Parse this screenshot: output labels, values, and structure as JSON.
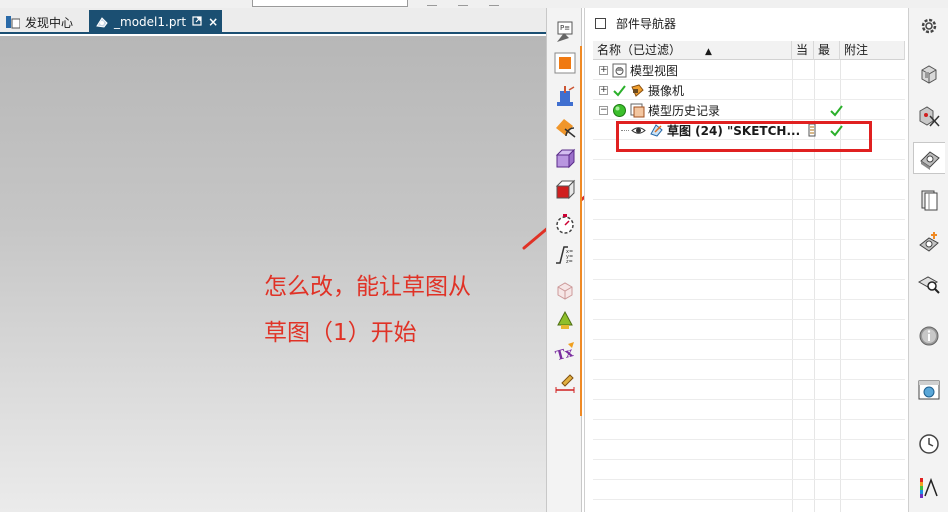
{
  "window": {
    "tabs": [
      {
        "label": "发现中心",
        "active": false
      },
      {
        "label": "_model1.prt",
        "active": true,
        "close_symbol": "×"
      }
    ]
  },
  "graphics": {
    "annotation_line1": "怎么改，能让草图从",
    "annotation_line2": "草图（1）开始",
    "annotation_color": "#e03226"
  },
  "vtoolbar": {
    "icons": [
      "selection-filter-icon",
      "orange-square-icon",
      "datum-csys-icon",
      "sketch-section-icon",
      "cube-wireframe-icon",
      "red-cube-icon",
      "clock-dial-icon",
      "expression-icon",
      "transparent-cube-icon",
      "lamp-icon",
      "text-icon",
      "measure-brush-icon"
    ]
  },
  "navigator": {
    "title": "部件导航器",
    "columns": {
      "name": "名称（已过滤）",
      "current": "当",
      "latest": "最",
      "notes": "附注"
    },
    "rows": [
      {
        "label": "模型视图",
        "expander": "+",
        "icon": "model-view-icon",
        "latest_check": false
      },
      {
        "label": "摄像机",
        "expander": "+",
        "icon": "camera-icon",
        "latest_check": false
      },
      {
        "label": "模型历史记录",
        "expander": "−",
        "icon": "history-icon",
        "latest_check": true
      },
      {
        "label": "草图 (24) \"SKETCH...",
        "expander": "",
        "icon": "sketch-icon",
        "latest_check": true
      }
    ],
    "check_color": "#2bb02b",
    "highlight_color": "#e02020"
  },
  "resource_bar": {
    "icons": [
      "settings-gear-icon",
      "assembly-navigator-icon",
      "constraint-navigator-icon",
      "part-navigator-icon",
      "reuse-library-icon",
      "hd3d-tools-icon",
      "web-browser-icon",
      "history-icon",
      "process-studio-icon",
      "roles-icon",
      "system-materials-icon"
    ]
  }
}
